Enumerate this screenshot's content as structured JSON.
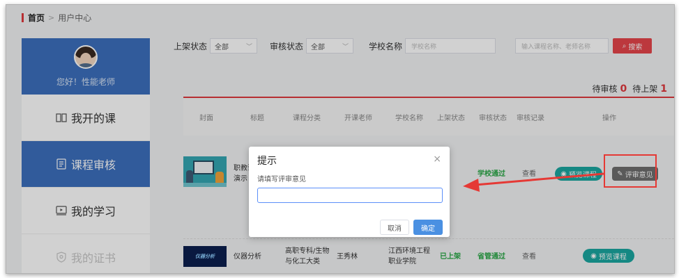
{
  "breadcrumb": {
    "home": "首页",
    "separator": ">",
    "current": "用户中心"
  },
  "profile": {
    "greeting": "您好！性能老师"
  },
  "sidebar": {
    "items": [
      {
        "label": "我开的课",
        "icon": "book-icon"
      },
      {
        "label": "课程审核",
        "icon": "document-icon"
      },
      {
        "label": "我的学习",
        "icon": "video-icon"
      },
      {
        "label": "我的证书",
        "icon": "certificate-icon"
      }
    ]
  },
  "filters": {
    "shelf_status_label": "上架状态",
    "shelf_status_value": "全部",
    "review_status_label": "审核状态",
    "review_status_value": "全部",
    "school_label": "学校名称",
    "school_placeholder": "学校名称",
    "keyword_placeholder": "输入课程名称、老师名称",
    "search_label": "搜索"
  },
  "pending": {
    "review_label": "待审核",
    "review_count": "0",
    "shelf_label": "待上架",
    "shelf_count": "1"
  },
  "table": {
    "headers": [
      "封面",
      "标题",
      "课程分类",
      "开课老师",
      "学校名称",
      "上架状态",
      "审核状态",
      "审核记录",
      "操作"
    ],
    "rows": [
      {
        "title": "职教课程演示",
        "title_line1": "职教课",
        "title_line2": "演示",
        "status": "学校通过",
        "record": "查看",
        "preview": "预览课程",
        "review": "评审意见"
      },
      {
        "thumb_text": "仪器分析",
        "title": "仪器分析",
        "category": "高职专科/生物与化工大类",
        "category_line1": "高职专科/生物",
        "category_line2": "与化工大类",
        "teacher": "王秀林",
        "school": "江西环境工程职业学院",
        "school_line1": "江西环境工程",
        "school_line2": "职业学院",
        "shelf": "已上架",
        "status": "省管通过",
        "record": "查看",
        "preview": "预览课程"
      }
    ]
  },
  "dialog": {
    "title": "提示",
    "close": "×",
    "label": "请填写评审意见",
    "cancel": "取消",
    "confirm": "确定"
  },
  "colors": {
    "accent_red": "#e0393e",
    "sidebar_blue": "#3c6fbd",
    "teal": "#1aa7a0",
    "primary_blue": "#4a90e2"
  }
}
